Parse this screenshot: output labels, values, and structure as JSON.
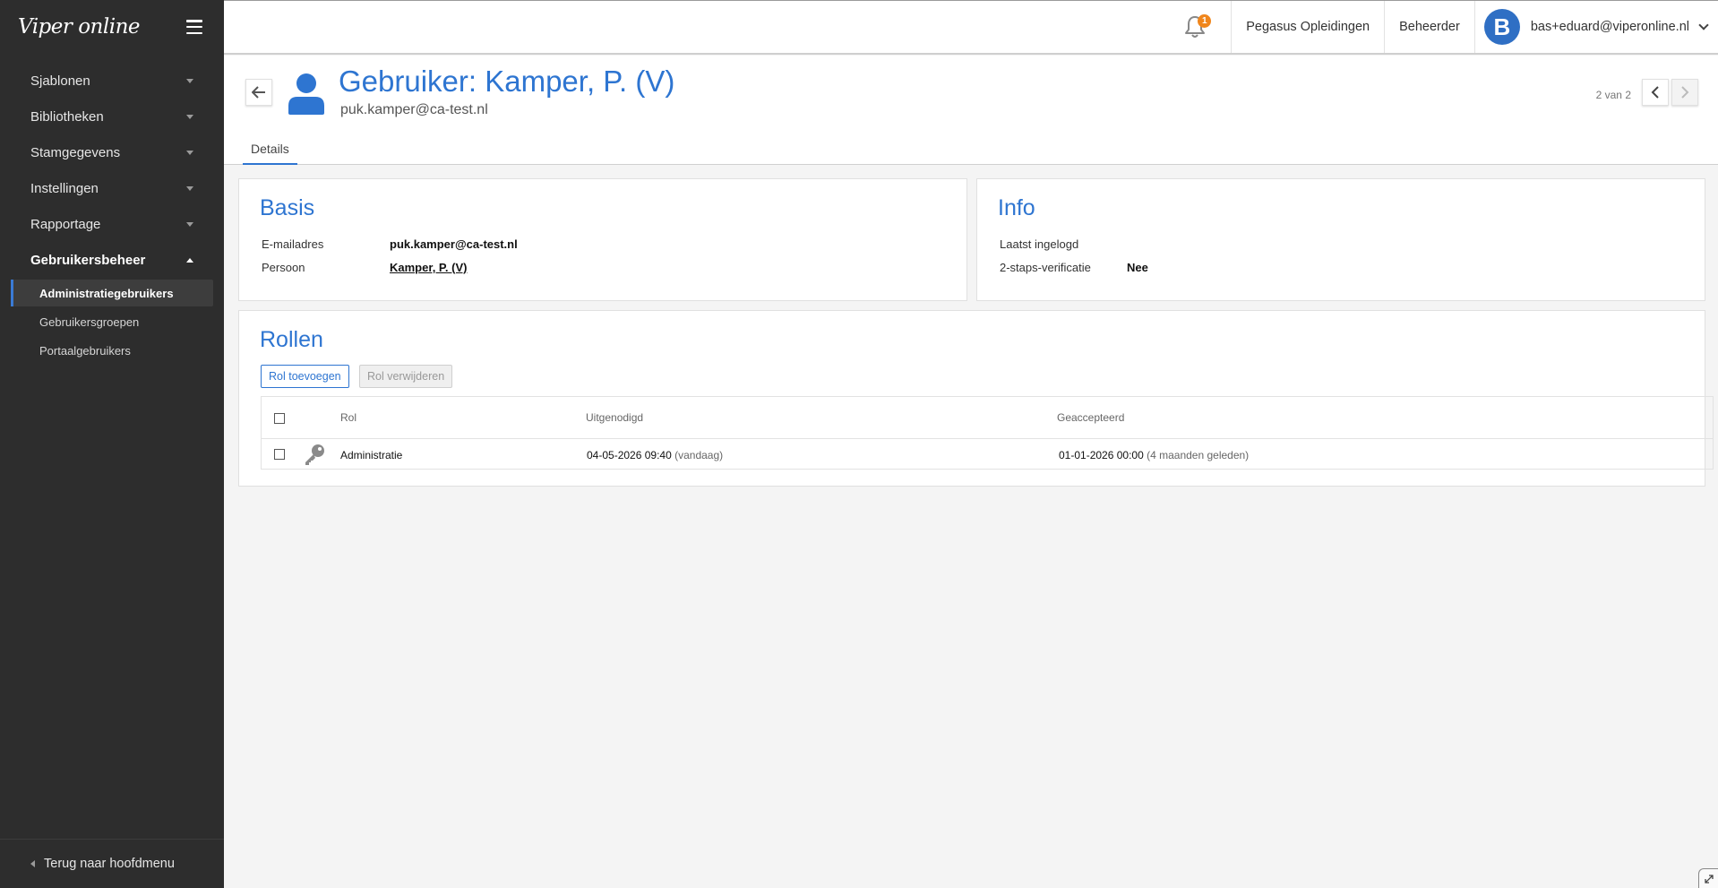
{
  "app": {
    "logo": "Viper online"
  },
  "sidebar": {
    "items": [
      {
        "label": "Sjablonen"
      },
      {
        "label": "Bibliotheken"
      },
      {
        "label": "Stamgegevens"
      },
      {
        "label": "Instellingen"
      },
      {
        "label": "Rapportage"
      },
      {
        "label": "Gebruikersbeheer"
      }
    ],
    "subitems": [
      {
        "label": "Administratiegebruikers"
      },
      {
        "label": "Gebruikersgroepen"
      },
      {
        "label": "Portaalgebruikers"
      }
    ],
    "footer": "Terug naar hoofdmenu"
  },
  "topbar": {
    "notification_count": "1",
    "org": "Pegasus Opleidingen",
    "role": "Beheerder",
    "avatar_letter": "B",
    "user_email": "bas+eduard@viperonline.nl"
  },
  "header": {
    "title": "Gebruiker: Kamper, P. (V)",
    "subtitle": "puk.kamper@ca-test.nl",
    "pager": "2 van 2",
    "tab": "Details"
  },
  "basis": {
    "title": "Basis",
    "email_label": "E-mailadres",
    "email_value": "puk.kamper@ca-test.nl",
    "person_label": "Persoon",
    "person_value": "Kamper, P. (V)"
  },
  "info": {
    "title": "Info",
    "last_login_label": "Laatst ingelogd",
    "last_login_value": "",
    "twofa_label": "2-staps-verificatie",
    "twofa_value": "Nee"
  },
  "rollen": {
    "title": "Rollen",
    "add_button": "Rol toevoegen",
    "remove_button": "Rol verwijderen",
    "columns": {
      "rol": "Rol",
      "uitgenodigd": "Uitgenodigd",
      "geaccepteerd": "Geaccepteerd"
    },
    "rows": [
      {
        "rol": "Administratie",
        "uitgenodigd": "04-05-2026 09:40",
        "uitgenodigd_rel": "(vandaag)",
        "geaccepteerd": "01-01-2026 00:00",
        "geaccepteerd_rel": "(4 maanden geleden)"
      }
    ]
  },
  "colors": {
    "accent": "#2e75d1",
    "sidebar": "#2d2d2d",
    "badge": "#f0861c"
  }
}
